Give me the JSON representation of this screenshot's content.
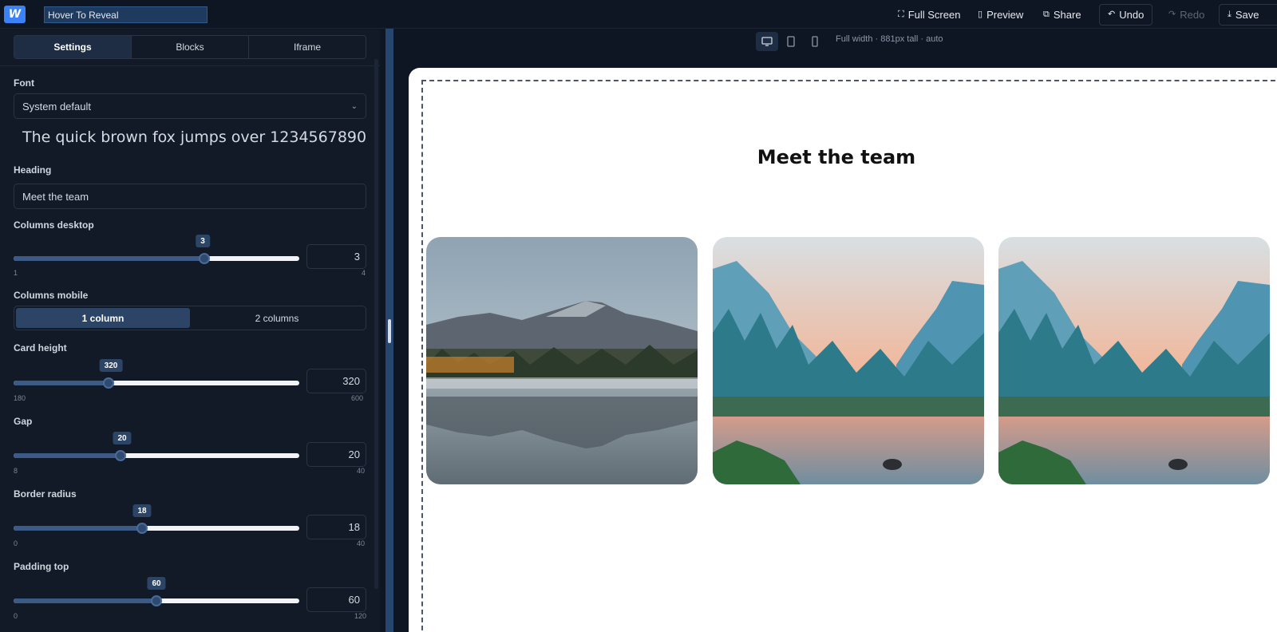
{
  "topbar": {
    "logo_text": "W",
    "title_value": "Hover To Reveal",
    "full_screen": "Full Screen",
    "preview": "Preview",
    "share": "Share",
    "undo": "Undo",
    "redo": "Redo",
    "save": "Save"
  },
  "panel": {
    "tabs": [
      "Settings",
      "Blocks",
      "Iframe"
    ],
    "font": {
      "label": "Font",
      "value": "System default",
      "preview": "The quick brown fox jumps over 1234567890"
    },
    "heading": {
      "label": "Heading",
      "value": "Meet the team"
    },
    "columns_desktop": {
      "label": "Columns desktop",
      "value": "3",
      "min": "1",
      "max": "4",
      "fraction": 0.667
    },
    "columns_mobile": {
      "label": "Columns mobile",
      "options": [
        "1 column",
        "2 columns"
      ],
      "selected": "1 column"
    },
    "card_height": {
      "label": "Card height",
      "value": "320",
      "min": "180",
      "max": "600",
      "fraction": 0.333
    },
    "gap": {
      "label": "Gap",
      "value": "20",
      "min": "8",
      "max": "40",
      "fraction": 0.375
    },
    "border_radius": {
      "label": "Border radius",
      "value": "18",
      "min": "0",
      "max": "40",
      "fraction": 0.45
    },
    "padding_top": {
      "label": "Padding top",
      "value": "60",
      "min": "0",
      "max": "120",
      "fraction": 0.5
    }
  },
  "canvas": {
    "devices": [
      "desktop-icon",
      "tablet-icon",
      "mobile-icon"
    ],
    "dims_text": "Full width · 881px tall · auto",
    "heading": "Meet the team",
    "cards": [
      "mountain-lake-image",
      "valley-river-image",
      "valley-river-image"
    ]
  },
  "colors": {
    "accent": "#3b82f6",
    "panel_bg": "#121a27",
    "app_bg": "#0f1623",
    "active_tab": "#1e2d44"
  }
}
